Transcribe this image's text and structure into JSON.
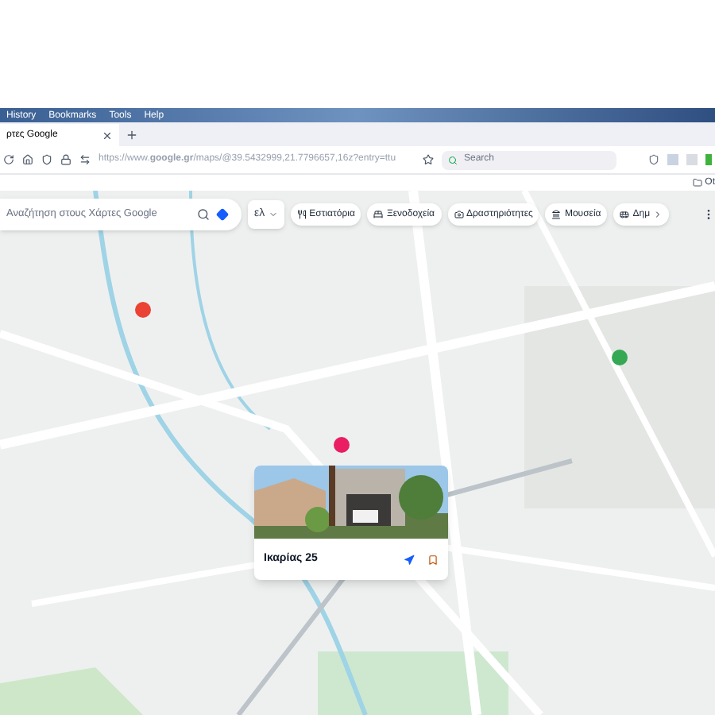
{
  "menu_bar": [
    "History",
    "Bookmarks",
    "Tools",
    "Help"
  ],
  "tab": {
    "title": "ρτες Google",
    "selected": true
  },
  "address_bar": {
    "url": "https://www.**google.gr**/maps/@39.5432999,21.7796657,16z?entry=ttu"
  },
  "search_field": {
    "placeholder": "Search"
  },
  "bookmarks_bar": {
    "item": "Ot"
  },
  "maps": {
    "search": {
      "placeholder": "Αναζήτηση στους Χάρτες Google"
    },
    "layer_label": "ελ",
    "categories": [
      {
        "label": "Εστιατόρια",
        "kind": "restaurant"
      },
      {
        "label": "Ξενοδοχεία",
        "kind": "hotel"
      },
      {
        "label": "Δραστηριότητες",
        "kind": "activity"
      },
      {
        "label": "Μουσεία",
        "kind": "museum"
      },
      {
        "label": "Δημ",
        "kind": "transit"
      }
    ],
    "place_card": {
      "title": "Ικαρίας 25"
    }
  }
}
